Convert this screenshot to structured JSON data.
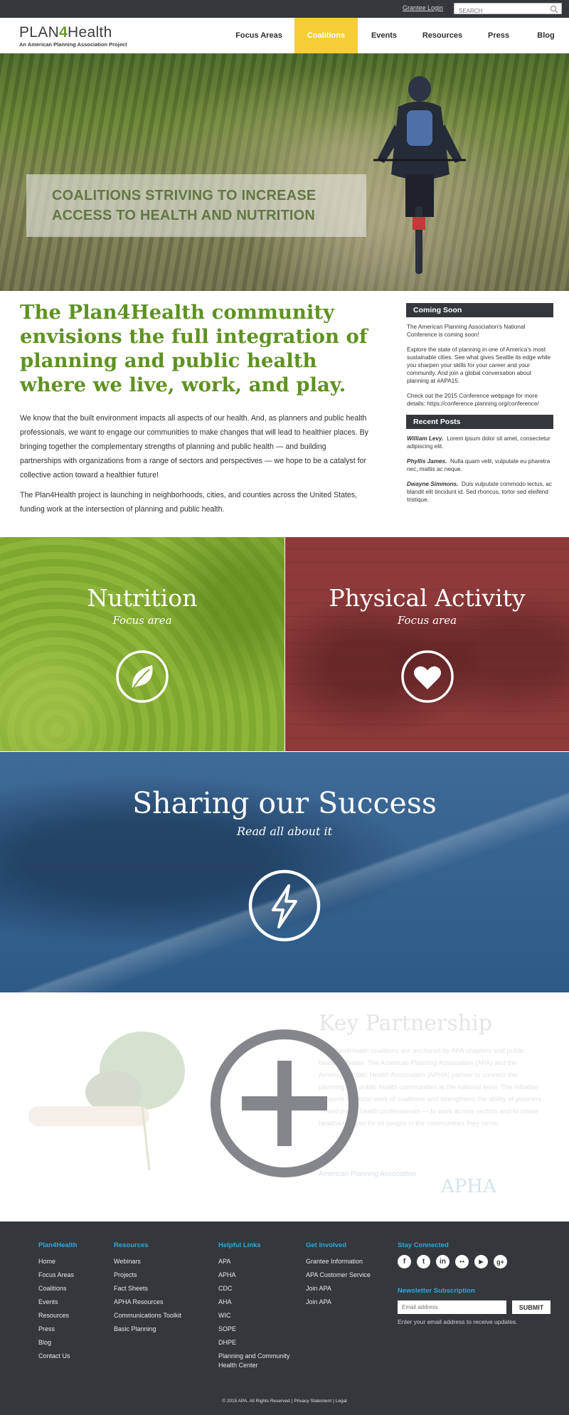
{
  "topbar": {
    "grantee_login": "Grantee Login",
    "search_placeholder": "SEARCH"
  },
  "logo": {
    "name_pre": "PLAN",
    "name_four": "4",
    "name_post": "Health",
    "tagline": "An American Planning Association Project"
  },
  "nav": {
    "items": [
      "Focus Areas",
      "Coalitions",
      "Events",
      "Resources",
      "Press",
      "Blog"
    ],
    "active": "Coalitions"
  },
  "hero": {
    "caption_line1": "COALITIONS STRIVING TO INCREASE",
    "caption_line2": "ACCESS TO HEALTH AND NUTRITION"
  },
  "main": {
    "headline": "The Plan4Health community envisions the full integration of planning and public health where we live, work, and play.",
    "paragraph1": "We know that the built environment impacts all aspects of our health. And, as planners and public health professionals, we want to engage our communities to make changes that will lead to healthier places. By bringing together the complementary strengths of planning and public health — and building partnerships with organizations from a range of sectors and perspectives — we hope to be a catalyst for collective action toward a healthier future!",
    "paragraph2": "The Plan4Health project is launching in neighborhoods, cities, and counties across the United States, funding work at the intersection of planning and public health."
  },
  "sidebar": {
    "coming_soon_heading": "Coming Soon",
    "coming_soon_p1": "The American Planning Association's National Conference is coming soon!",
    "coming_soon_p2": "Explore the state of planning in one of America's most sustainable cities. See what gives Seattle its edge while you sharpen your skills for your career and your community. And join a global conversation about planning at #APA15.",
    "coming_soon_p3": "Check out the 2015 Conference webpage for more details: https://conference.planning.org/conference/",
    "recent_posts_heading": "Recent Posts",
    "posts": [
      {
        "author": "William Levy.",
        "text": "Lorem ipsum dolor sit amet, consectetur adipiscing elit."
      },
      {
        "author": "Phyllis James.",
        "text": "Nulla quam velit, vulputate eu pharetra nec, mattis ac neque."
      },
      {
        "author": "Dwayne Simmons.",
        "text": "Duis vulputate commodo lectus, ac blandit elit tincidunt id. Sed rhoncus, tortor sed eleifend tristique."
      }
    ]
  },
  "tiles": {
    "nutrition_title": "Nutrition",
    "nutrition_sub": "Focus area",
    "activity_title": "Physical Activity",
    "activity_sub": "Focus area"
  },
  "sharing": {
    "title": "Sharing our Success",
    "subtitle": "Read all about it"
  },
  "partnership": {
    "title": "Key Partnership",
    "text": "The Plan4Health coalitions are anchored by APA chapters and public health affiliates. The American Planning Association (APA) and the American Public Health Association (APHA) partner to connect the planning and public health communities at the national level. The initiative supports the local work of coalitions and strengthens the ability of planners — and public health professionals — to work across sectors and to create healthier places for all people in the communities they serve.",
    "logo1": "American Planning Association",
    "logo2": "APHA"
  },
  "footer": {
    "col1_title": "Plan4Health",
    "col1_links": [
      "Home",
      "Focus Areas",
      "Coalitions",
      "Events",
      "Resources",
      "Press",
      "Blog",
      "Contact Us"
    ],
    "col2_title": "Resources",
    "col2_links": [
      "Webinars",
      "Projects",
      "Fact Sheets",
      "APHA Resources",
      "Communications Toolkit",
      "Basic Planning"
    ],
    "col3_title": "Helpful Links",
    "col3_links": [
      "APA",
      "APHA",
      "CDC",
      "AHA",
      "WIC",
      "SOPE",
      "DHPE",
      "Planning and Community Health Center"
    ],
    "col4_title": "Get Involved",
    "col4_links": [
      "Grantee Information",
      "APA Customer Service",
      "Join APA",
      "Join APA"
    ],
    "stay_connected": "Stay Connected",
    "social": [
      "f",
      "t",
      "in",
      "●●",
      "▶",
      "g+"
    ],
    "newsletter_title": "Newsletter Subscription",
    "email_placeholder": "Email address",
    "submit": "SUBMIT",
    "newsletter_note": "Enter your email address to receive updates.",
    "copyright": "© 2015 APA. All Rights Reserved",
    "privacy": "Privacy Statement",
    "legal": "Legal"
  },
  "colors": {
    "brand_green": "#6a9a24",
    "nav_active": "#f5cd36",
    "dark": "#34383c",
    "footer_heading": "#2aa9e0",
    "tile_green": "#86ad36",
    "tile_red": "#8a3838",
    "sharing_blue": "#35628e"
  },
  "icons": {
    "search": "search-icon",
    "leaf": "leaf-icon",
    "heart": "heart-icon",
    "lightning": "lightning-icon",
    "plus": "plus-circle-icon"
  }
}
